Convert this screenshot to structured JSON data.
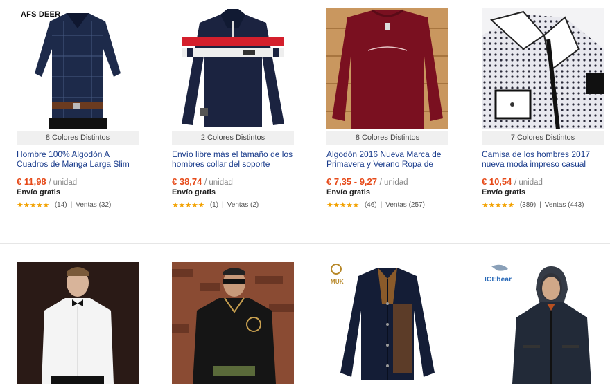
{
  "products_row1": [
    {
      "brand": "AFS DEER",
      "colors_label": "8 Colores Distintos",
      "title": "Hombre 100% Algodón A Cuadros de Manga Larga Slim Fit",
      "price": "€ 11,98",
      "unit": "/ unidad",
      "shipping": "Envío gratis",
      "stars": "★★★★★",
      "reviews": "(14)",
      "sales": "Ventas (32)"
    },
    {
      "brand": "",
      "colors_label": "2 Colores Distintos",
      "title": "Envío libre más el tamaño de los hombres collar del soporte",
      "price": "€ 38,74",
      "unit": "/ unidad",
      "shipping": "Envío gratis",
      "stars": "★★★★★",
      "reviews": "(1)",
      "sales": "Ventas (2)"
    },
    {
      "brand": "",
      "colors_label": "8 Colores Distintos",
      "title": "Algodón 2016 Nueva Marca de Primavera y Verano Ropa de Los",
      "price": "€ 7,35 - 9,27",
      "unit": "/ unidad",
      "shipping": "Envío gratis",
      "stars": "★★★★★",
      "reviews": "(46)",
      "sales": "Ventas (257)"
    },
    {
      "brand": "",
      "colors_label": "7 Colores Distintos",
      "title": "Camisa de los hombres 2017 nueva moda impreso casual",
      "price": "€ 10,54",
      "unit": "/ unidad",
      "shipping": "Envío gratis",
      "stars": "★★★★★",
      "reviews": "(389)",
      "sales": "Ventas (443)"
    }
  ],
  "products_row2": [
    {
      "brand": ""
    },
    {
      "brand": ""
    },
    {
      "brand": "MUK"
    },
    {
      "brand": "ICEbear"
    }
  ],
  "colors": {
    "price": "#e64a19",
    "title_link": "#1a3c8c",
    "stars": "#f2a100"
  },
  "separator": "|"
}
